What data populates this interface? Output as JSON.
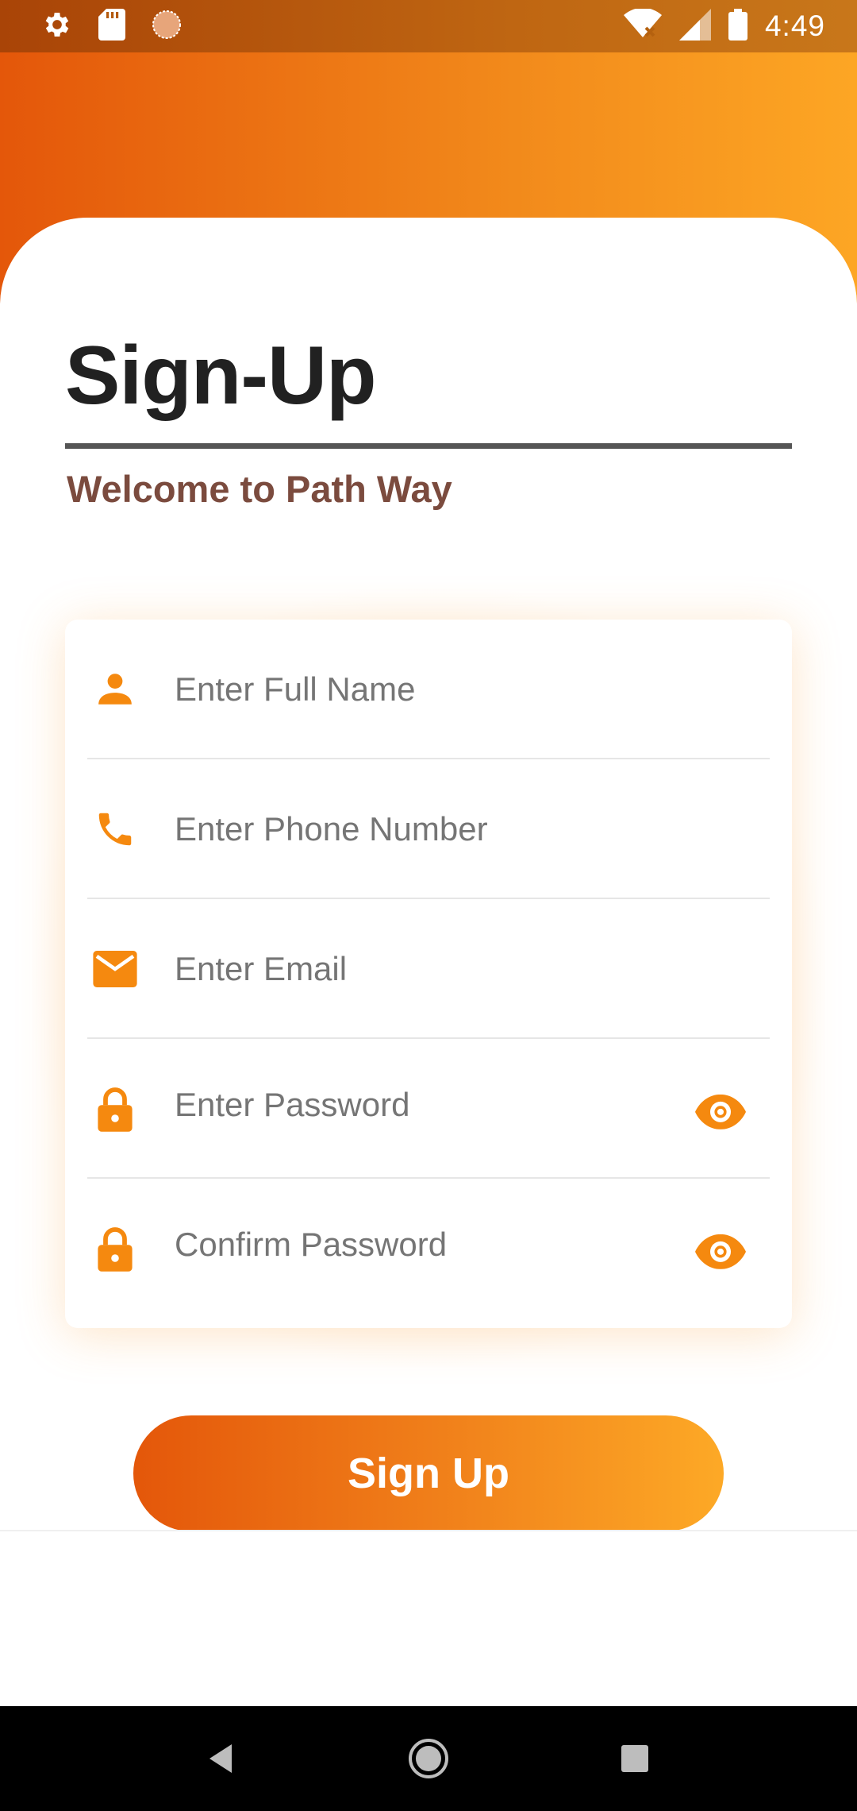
{
  "status_bar": {
    "time": "4:49",
    "left_icons": [
      "settings-icon",
      "sd-card-icon",
      "loading-icon"
    ],
    "right_icons": [
      "wifi-icon",
      "signal-icon",
      "battery-icon"
    ]
  },
  "page": {
    "title": "Sign-Up",
    "subtitle": "Welcome to Path Way"
  },
  "form": {
    "full_name": {
      "placeholder": "Enter Full Name",
      "value": "",
      "icon": "person-icon"
    },
    "phone": {
      "placeholder": "Enter Phone Number",
      "value": "",
      "icon": "phone-icon"
    },
    "email": {
      "placeholder": "Enter Email",
      "value": "",
      "icon": "mail-icon"
    },
    "password": {
      "placeholder": "Enter Password",
      "value": "",
      "icon": "lock-icon",
      "toggle_icon": "eye-icon"
    },
    "confirm_password": {
      "placeholder": "Confirm Password",
      "value": "",
      "icon": "lock-icon",
      "toggle_icon": "eye-icon"
    }
  },
  "actions": {
    "signup_label": "Sign Up"
  },
  "colors": {
    "accent": "#f5890f",
    "gradient_start": "#e4570a",
    "gradient_end": "#fda624",
    "title": "#212121",
    "subtitle": "#7b4b3e"
  },
  "nav_bar": {
    "buttons": [
      "back-icon",
      "home-icon",
      "recents-icon"
    ]
  }
}
